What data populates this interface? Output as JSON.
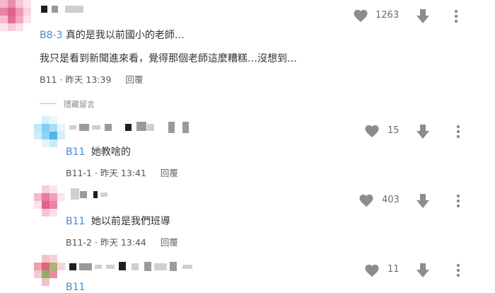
{
  "main_comment": {
    "tag": "B8-3",
    "line1": "真的是我以前國小的老師…",
    "line2": "我只是看到新聞進來看，覺得那個老師這麼糟糕…沒想到…",
    "floor": "B11",
    "time": "昨天 13:39",
    "reply_label": "回覆",
    "likes": "1263"
  },
  "hidden_label": "隱藏留言",
  "replies": [
    {
      "tag": "B11",
      "text": "她教啥的",
      "floor": "B11-1",
      "time": "昨天 13:41",
      "reply_label": "回覆",
      "likes": "15"
    },
    {
      "tag": "B11",
      "text": "她以前是我們班導",
      "floor": "B11-2",
      "time": "昨天 13:44",
      "reply_label": "回覆",
      "likes": "403"
    },
    {
      "tag": "B11",
      "text": "",
      "likes": "11"
    }
  ],
  "colors": {
    "tag_blue": "#3f8ed6",
    "icon_gray": "#8c8c8c"
  },
  "icons": [
    "heart-icon",
    "thumb-down-arrow-icon",
    "more-vertical-icon"
  ]
}
